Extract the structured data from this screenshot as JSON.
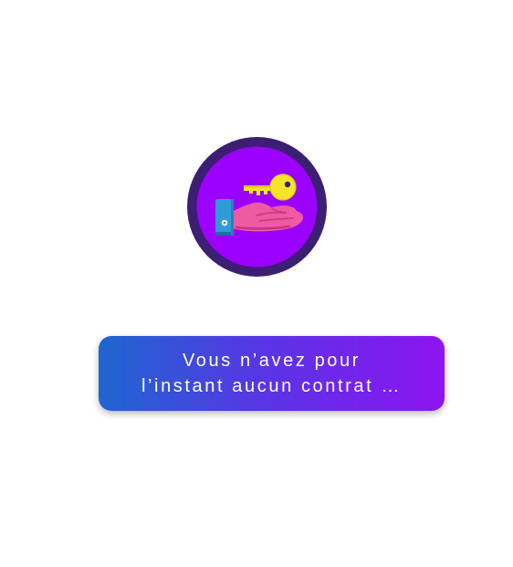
{
  "empty_state": {
    "illustration_icon": "hand-holding-key-icon",
    "message": "Vous n’avez pour\nl’instant aucun contrat …"
  },
  "colors": {
    "badge_ring": "#3c1f73",
    "badge_fill": "#9c00ff",
    "key": "#f5e52a",
    "hand": "#ef5aa5",
    "sleeve": "#2f9bd9",
    "message_gradient_start": "#1f66d0",
    "message_gradient_end": "#8e14f0",
    "message_text": "#ffffff"
  }
}
